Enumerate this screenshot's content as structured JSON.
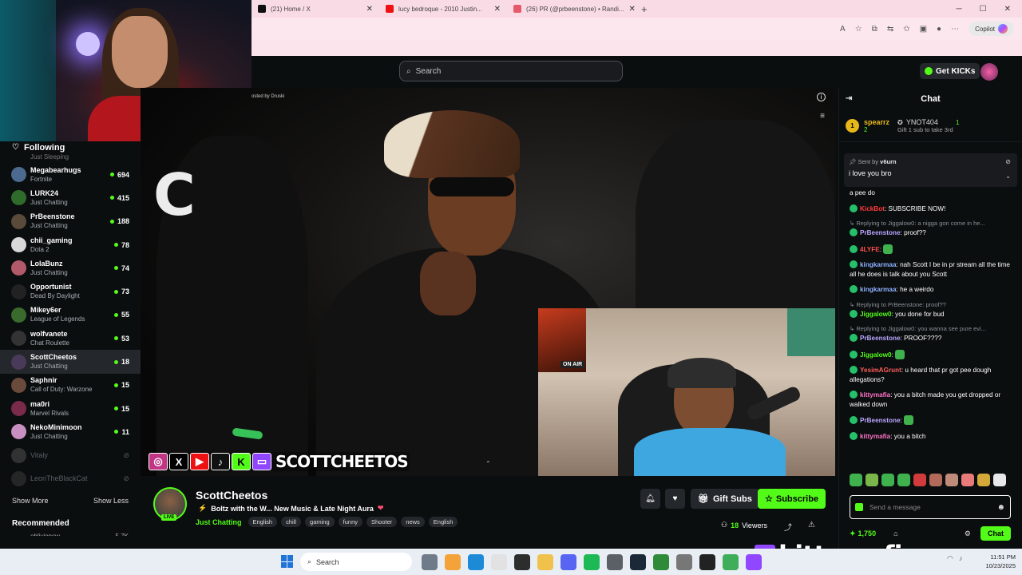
{
  "browser": {
    "tabs": [
      {
        "title": "(21) Home / X",
        "favicon_color": "#111111"
      },
      {
        "title": "lucy bedroque - 2010 Justin...",
        "favicon_color": "#e11b1b"
      },
      {
        "title": "(26) PR (@prbeenstone) • Randi...",
        "favicon_color": "#e45a6a"
      }
    ],
    "new_tab": "+",
    "copilot_label": "Copilot"
  },
  "header": {
    "search_placeholder": "Search",
    "get_kicks_label": "Get KICKs"
  },
  "sidebar": {
    "following_label": "Following",
    "cut_text": "Just Sleeping",
    "channels": [
      {
        "name": "Megabearhugs",
        "category": "Fortnite",
        "viewers": "694",
        "color": "#4c6a8f"
      },
      {
        "name": "LURK24",
        "category": "Just Chatting",
        "viewers": "415",
        "color": "#2f6b2a"
      },
      {
        "name": "PrBeenstone",
        "category": "Just Chatting",
        "viewers": "188",
        "color": "#5a4a3a"
      },
      {
        "name": "chii_gaming",
        "category": "Dota 2",
        "viewers": "78",
        "color": "#d8d8d8"
      },
      {
        "name": "LolaBunz",
        "category": "Just Chatting",
        "viewers": "74",
        "color": "#b35a6a"
      },
      {
        "name": "Opportunist",
        "category": "Dead By Daylight",
        "viewers": "73",
        "color": "#222222"
      },
      {
        "name": "Mikey6er",
        "category": "League of Legends",
        "viewers": "55",
        "color": "#3a6b2c"
      },
      {
        "name": "wolfvanete",
        "category": "Chat Roulette",
        "viewers": "53",
        "color": "#333333"
      },
      {
        "name": "ScottCheetos",
        "category": "Just Chatting",
        "viewers": "18",
        "color": "#4a3a5a",
        "active": true
      },
      {
        "name": "Saphnir",
        "category": "Call of Duty: Warzone",
        "viewers": "15",
        "color": "#6a4a3a"
      },
      {
        "name": "ma0ri",
        "category": "Marvel Rivals",
        "viewers": "15",
        "color": "#7a2a4a"
      },
      {
        "name": "NekoMinimoon",
        "category": "Just Chatting",
        "viewers": "11",
        "color": "#c890c0"
      }
    ],
    "offline": [
      {
        "name": "Vitaly",
        "color": "#777777"
      },
      {
        "name": "LeonTheBlackCat",
        "color": "#555555"
      }
    ],
    "show_more": "Show More",
    "show_less": "Show Less",
    "recommended_label": "Recommended",
    "recommended_first": {
      "name": "oblivionsw...",
      "viewers": "5.7K"
    }
  },
  "video": {
    "hosted_by": "osted by Druski",
    "channel_logo": "C",
    "social_handle": "SCOTTCHEETOS",
    "social_icons": [
      "instagram-icon",
      "x-icon",
      "youtube-icon",
      "tiktok-icon",
      "kick-icon",
      "twitch-icon"
    ],
    "pip_sign": "ON AIR"
  },
  "stream": {
    "streamer": "ScottCheetos",
    "live_label": "LIVE",
    "title": "Boltz with the W... New Music & Late Night Aura",
    "category": "Just Chatting",
    "tags": [
      "English",
      "chill",
      "gaming",
      "funny",
      "Shooter",
      "news",
      "English"
    ],
    "gift_subs_label": "Gift Subs",
    "subscribe_label": "Subscribe",
    "viewers_count": "18",
    "viewers_label": "Viewers"
  },
  "chat": {
    "title": "Chat",
    "leaderboard": {
      "first": {
        "rank": "1",
        "name": "spearrz",
        "count": "2"
      },
      "second": {
        "name": "YNOT404",
        "count": "1"
      },
      "gift_text": "Gift 1 sub to take 3rd"
    },
    "pinned": {
      "sent_by_label": "Sent by",
      "sender": "v6urn",
      "message": "i love you bro"
    },
    "messages": [
      {
        "reply": "",
        "user": "",
        "color": "#ffffff",
        "text": "a pee do"
      },
      {
        "reply": "",
        "user": "KickBot",
        "color": "#ff3b3b",
        "text": ": SUBSCRIBE NOW!"
      },
      {
        "reply": "Replying to Jiggalow0: a nigga gon come in he...",
        "user": "PrBeenstone",
        "color": "#b9a4ff",
        "text": ": proof??"
      },
      {
        "reply": "",
        "user": "4LYFE",
        "color": "#ff4d4d",
        "text": ":"
      },
      {
        "reply": "",
        "user": "kingkarmaa",
        "color": "#8fb0ff",
        "text": ": nah Scott I be in pr stream all the time all he does is talk about you Scott"
      },
      {
        "reply": "",
        "user": "kingkarmaa",
        "color": "#8fb0ff",
        "text": ": he a weirdo"
      },
      {
        "reply": "Replying to PrBeenstone: proof??",
        "user": "Jiggalow0",
        "color": "#53fc18",
        "text": ": you done for bud"
      },
      {
        "reply": "Replying to Jiggalow0: you wanna see pure evi...",
        "user": "PrBeenstone",
        "color": "#b9a4ff",
        "text": ": PROOF????"
      },
      {
        "reply": "",
        "user": "Jiggalow0",
        "color": "#53fc18",
        "text": ":"
      },
      {
        "reply": "",
        "user": "YesimAGrunt",
        "color": "#ff5c5c",
        "text": ": u heard that pr got pee dough allegations?"
      },
      {
        "reply": "",
        "user": "kittymafia",
        "color": "#ff73c6",
        "text": ": you a bitch made you get dropped or walked down"
      },
      {
        "reply": "",
        "user": "PrBeenstone",
        "color": "#b9a4ff",
        "text": ":"
      },
      {
        "reply": "",
        "user": "kittymafia",
        "color": "#ff73c6",
        "text": ": you a bitch"
      }
    ],
    "emote_colors": [
      "#3fb14d",
      "#7ab64a",
      "#3fb14d",
      "#3fb14d",
      "#d23b3b",
      "#b46a5a",
      "#c08a7a",
      "#e87a7a",
      "#d4a93a",
      "#e8e8e8"
    ],
    "input_placeholder": "Send a message",
    "kicks_count": "1,750",
    "send_label": "Chat"
  },
  "overlay": {
    "kitty_text": "kittymafiaa"
  },
  "taskbar": {
    "search_placeholder": "Search",
    "app_colors": [
      "#6f7b89",
      "#f3a33a",
      "#1d8ad8",
      "#e2e2e2",
      "#2d2d2d",
      "#f0c14b",
      "#5865f2",
      "#1db954",
      "#5b6066",
      "#1b2838",
      "#2f8a3a",
      "#777777",
      "#222222",
      "#3fae5a",
      "#9146ff"
    ],
    "time": "11:51 PM",
    "date": "10/23/2025"
  }
}
